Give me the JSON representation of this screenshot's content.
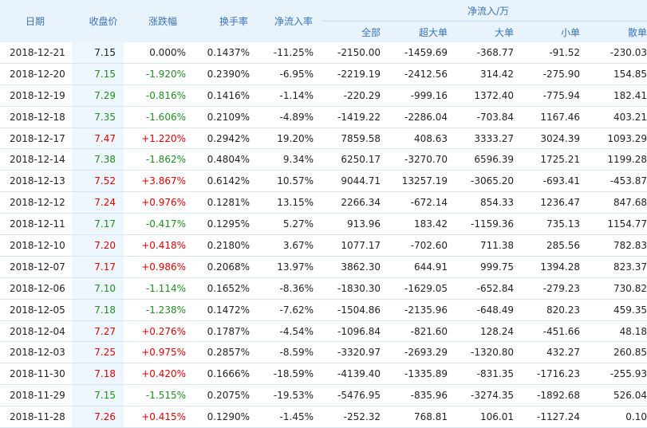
{
  "headers": {
    "date": "日期",
    "close": "收盘价",
    "change": "涨跌幅",
    "turnover": "换手率",
    "net_inflow_rate": "净流入率",
    "net_inflow_group": "净流入/万",
    "total": "全部",
    "super_large": "超大单",
    "large": "大单",
    "small": "小单",
    "retail": "散单"
  },
  "icons": {
    "sort": "sort-down-arrow-icon"
  },
  "colors": {
    "up": "#e00000",
    "down": "#228b22",
    "header_text": "#3973b8",
    "header_bg": "#e8f3fc"
  },
  "rows": [
    {
      "date": "2018-12-21",
      "close": "7.15",
      "change": "0.000%",
      "dir": "flat",
      "turnover": "0.1437%",
      "rate": "-11.25%",
      "total": "-2150.00",
      "super": "-1459.69",
      "large": "-368.77",
      "small": "-91.52",
      "retail": "-230.03"
    },
    {
      "date": "2018-12-20",
      "close": "7.15",
      "change": "-1.920%",
      "dir": "down",
      "turnover": "0.2390%",
      "rate": "-6.95%",
      "total": "-2219.19",
      "super": "-2412.56",
      "large": "314.42",
      "small": "-275.90",
      "retail": "154.85"
    },
    {
      "date": "2018-12-19",
      "close": "7.29",
      "change": "-0.816%",
      "dir": "down",
      "turnover": "0.1416%",
      "rate": "-1.14%",
      "total": "-220.29",
      "super": "-999.16",
      "large": "1372.40",
      "small": "-775.94",
      "retail": "182.41"
    },
    {
      "date": "2018-12-18",
      "close": "7.35",
      "change": "-1.606%",
      "dir": "down",
      "turnover": "0.2109%",
      "rate": "-4.89%",
      "total": "-1419.22",
      "super": "-2286.04",
      "large": "-703.84",
      "small": "1167.46",
      "retail": "403.21"
    },
    {
      "date": "2018-12-17",
      "close": "7.47",
      "change": "+1.220%",
      "dir": "up",
      "turnover": "0.2942%",
      "rate": "19.20%",
      "total": "7859.58",
      "super": "408.63",
      "large": "3333.27",
      "small": "3024.39",
      "retail": "1093.29"
    },
    {
      "date": "2018-12-14",
      "close": "7.38",
      "change": "-1.862%",
      "dir": "down",
      "turnover": "0.4804%",
      "rate": "9.34%",
      "total": "6250.17",
      "super": "-3270.70",
      "large": "6596.39",
      "small": "1725.21",
      "retail": "1199.28"
    },
    {
      "date": "2018-12-13",
      "close": "7.52",
      "change": "+3.867%",
      "dir": "up",
      "turnover": "0.6142%",
      "rate": "10.57%",
      "total": "9044.71",
      "super": "13257.19",
      "large": "-3065.20",
      "small": "-693.41",
      "retail": "-453.87"
    },
    {
      "date": "2018-12-12",
      "close": "7.24",
      "change": "+0.976%",
      "dir": "up",
      "turnover": "0.1281%",
      "rate": "13.15%",
      "total": "2266.34",
      "super": "-672.14",
      "large": "854.33",
      "small": "1236.47",
      "retail": "847.68"
    },
    {
      "date": "2018-12-11",
      "close": "7.17",
      "change": "-0.417%",
      "dir": "down",
      "turnover": "0.1295%",
      "rate": "5.27%",
      "total": "913.96",
      "super": "183.42",
      "large": "-1159.36",
      "small": "735.13",
      "retail": "1154.77"
    },
    {
      "date": "2018-12-10",
      "close": "7.20",
      "change": "+0.418%",
      "dir": "up",
      "turnover": "0.2180%",
      "rate": "3.67%",
      "total": "1077.17",
      "super": "-702.60",
      "large": "711.38",
      "small": "285.56",
      "retail": "782.83"
    },
    {
      "date": "2018-12-07",
      "close": "7.17",
      "change": "+0.986%",
      "dir": "up",
      "turnover": "0.2068%",
      "rate": "13.97%",
      "total": "3862.30",
      "super": "644.91",
      "large": "999.75",
      "small": "1394.28",
      "retail": "823.37"
    },
    {
      "date": "2018-12-06",
      "close": "7.10",
      "change": "-1.114%",
      "dir": "down",
      "turnover": "0.1652%",
      "rate": "-8.36%",
      "total": "-1830.30",
      "super": "-1629.05",
      "large": "-652.84",
      "small": "-279.23",
      "retail": "730.82"
    },
    {
      "date": "2018-12-05",
      "close": "7.18",
      "change": "-1.238%",
      "dir": "down",
      "turnover": "0.1472%",
      "rate": "-7.62%",
      "total": "-1504.86",
      "super": "-2135.96",
      "large": "-648.49",
      "small": "820.23",
      "retail": "459.35"
    },
    {
      "date": "2018-12-04",
      "close": "7.27",
      "change": "+0.276%",
      "dir": "up",
      "turnover": "0.1787%",
      "rate": "-4.54%",
      "total": "-1096.84",
      "super": "-821.60",
      "large": "128.24",
      "small": "-451.66",
      "retail": "48.18"
    },
    {
      "date": "2018-12-03",
      "close": "7.25",
      "change": "+0.975%",
      "dir": "up",
      "turnover": "0.2857%",
      "rate": "-8.59%",
      "total": "-3320.97",
      "super": "-2693.29",
      "large": "-1320.80",
      "small": "432.27",
      "retail": "260.85"
    },
    {
      "date": "2018-11-30",
      "close": "7.18",
      "change": "+0.420%",
      "dir": "up",
      "turnover": "0.1666%",
      "rate": "-18.59%",
      "total": "-4139.40",
      "super": "-1335.89",
      "large": "-831.35",
      "small": "-1716.23",
      "retail": "-255.93"
    },
    {
      "date": "2018-11-29",
      "close": "7.15",
      "change": "-1.515%",
      "dir": "down",
      "turnover": "0.2075%",
      "rate": "-19.53%",
      "total": "-5476.95",
      "super": "-835.96",
      "large": "-3274.35",
      "small": "-1892.68",
      "retail": "526.04"
    },
    {
      "date": "2018-11-28",
      "close": "7.26",
      "change": "+0.415%",
      "dir": "up",
      "turnover": "0.1290%",
      "rate": "-1.45%",
      "total": "-252.32",
      "super": "768.81",
      "large": "106.01",
      "small": "-1127.24",
      "retail": "0.10"
    }
  ]
}
